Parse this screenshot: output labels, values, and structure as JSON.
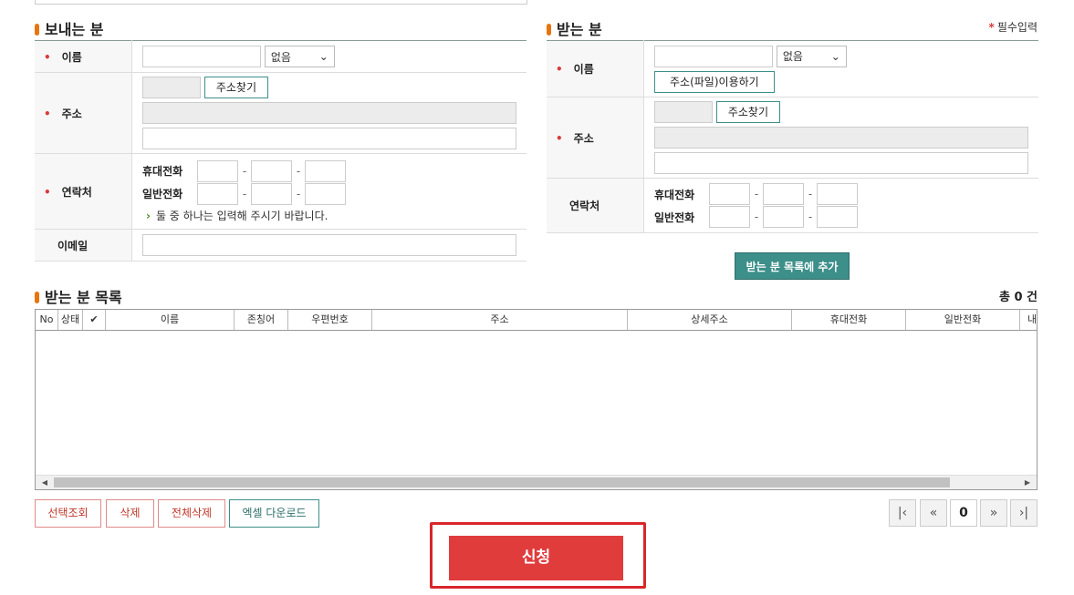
{
  "sender": {
    "title": "보내는 분",
    "name_label": "이름",
    "honorific": "없음",
    "address_label": "주소",
    "find_address": "주소찾기",
    "contact_label": "연락처",
    "mobile_label": "휴대전화",
    "phone_label": "일반전화",
    "hint": "둘 중 하나는 입력해 주시기 바랍니다.",
    "email_label": "이메일"
  },
  "receiver": {
    "title": "받는 분",
    "required_note": "필수입력",
    "name_label": "이름",
    "honorific": "없음",
    "file_address": "주소(파일)이용하기",
    "address_label": "주소",
    "find_address": "주소찾기",
    "contact_label": "연락처",
    "mobile_label": "휴대전화",
    "phone_label": "일반전화",
    "add_to_list": "받는 분 목록에 추가"
  },
  "list": {
    "title": "받는 분 목록",
    "total": "총 0 건",
    "columns": [
      "No",
      "상태",
      "",
      "이름",
      "존칭어",
      "우편번호",
      "주소",
      "상세주소",
      "휴대전화",
      "일반전화",
      "내용"
    ]
  },
  "actions": {
    "select_view": "선택조회",
    "delete": "삭제",
    "delete_all": "전체삭제",
    "excel_download": "엑셀 다운로드",
    "page": "0",
    "submit": "신청"
  },
  "colors": {
    "accent": "#3d8f8a",
    "submit": "#e03c3c",
    "required": "#d93a3a",
    "title_bar": "#e8740c"
  }
}
